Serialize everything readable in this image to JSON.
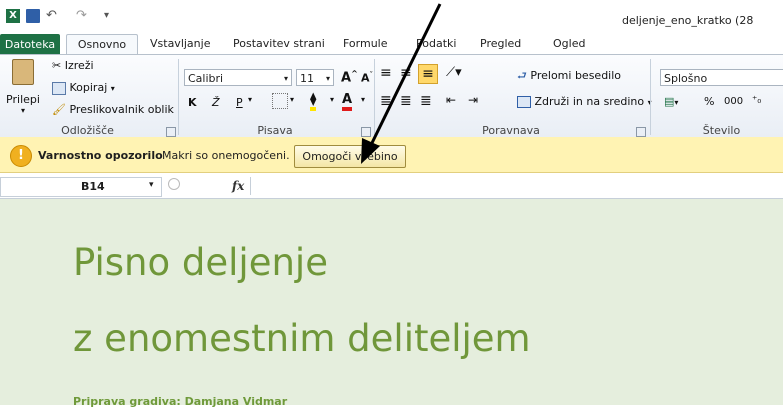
{
  "window": {
    "title": "deljenje_eno_kratko (28"
  },
  "tabs": [
    {
      "label": "Datoteka"
    },
    {
      "label": "Osnovno"
    },
    {
      "label": "Vstavljanje"
    },
    {
      "label": "Postavitev strani"
    },
    {
      "label": "Formule"
    },
    {
      "label": "Podatki"
    },
    {
      "label": "Pregled"
    },
    {
      "label": "Ogled"
    }
  ],
  "ribbon": {
    "clipboard": {
      "paste": "Prilepi",
      "cut": "Izreži",
      "copy": "Kopiraj",
      "format_painter": "Preslikovalnik oblik",
      "label": "Odložišče"
    },
    "font": {
      "name": "Calibri",
      "size": "11",
      "bold": "K",
      "italic": "Ž",
      "underline": "P",
      "label": "Pisava"
    },
    "alignment": {
      "wrap": "Prelomi besedilo",
      "merge": "Združi in na sredino",
      "label": "Poravnava"
    },
    "number": {
      "format": "Splošno",
      "percent": "%",
      "thousands": "000",
      "label": "Število"
    }
  },
  "message_bar": {
    "title": "Varnostno opozorilo",
    "text": "Makri so onemogočeni.",
    "button": "Omogoči vsebino"
  },
  "formula_bar": {
    "cell_ref": "B14",
    "fx": "fx"
  },
  "sheet": {
    "line1": "Pisno deljenje",
    "line2": "z enomestnim deliteljem",
    "author": "Priprava gradiva: Damjana Vidmar"
  },
  "colors": {
    "file_tab": "#1e7145",
    "title_green": "#70973a",
    "message_bar": "#fff3b3",
    "sheet_bg": "#e5eedd"
  }
}
